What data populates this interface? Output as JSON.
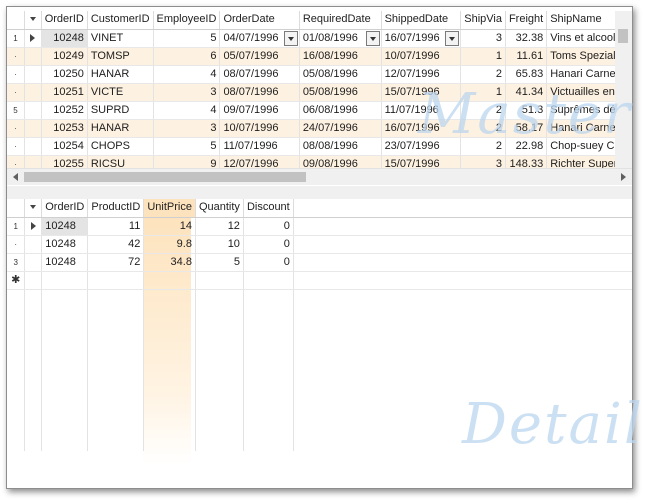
{
  "master": {
    "columns": [
      "OrderID",
      "CustomerID",
      "EmployeeID",
      "OrderDate",
      "RequiredDate",
      "ShippedDate",
      "ShipVia",
      "Freight",
      "ShipName"
    ],
    "rows": [
      {
        "indicator": "1",
        "OrderID": "10248",
        "CustomerID": "VINET",
        "EmployeeID": "5",
        "OrderDate": "04/07/1996",
        "RequiredDate": "01/08/1996",
        "ShippedDate": "16/07/1996",
        "ShipVia": "3",
        "Freight": "32.38",
        "ShipName": "Vins et alcools"
      },
      {
        "indicator": "·",
        "OrderID": "10249",
        "CustomerID": "TOMSP",
        "EmployeeID": "6",
        "OrderDate": "05/07/1996",
        "RequiredDate": "16/08/1996",
        "ShippedDate": "10/07/1996",
        "ShipVia": "1",
        "Freight": "11.61",
        "ShipName": "Toms Speziali"
      },
      {
        "indicator": "·",
        "OrderID": "10250",
        "CustomerID": "HANAR",
        "EmployeeID": "4",
        "OrderDate": "08/07/1996",
        "RequiredDate": "05/08/1996",
        "ShippedDate": "12/07/1996",
        "ShipVia": "2",
        "Freight": "65.83",
        "ShipName": "Hanari Carnes"
      },
      {
        "indicator": "·",
        "OrderID": "10251",
        "CustomerID": "VICTE",
        "EmployeeID": "3",
        "OrderDate": "08/07/1996",
        "RequiredDate": "05/08/1996",
        "ShippedDate": "15/07/1996",
        "ShipVia": "1",
        "Freight": "41.34",
        "ShipName": "Victuailles en"
      },
      {
        "indicator": "5",
        "OrderID": "10252",
        "CustomerID": "SUPRD",
        "EmployeeID": "4",
        "OrderDate": "09/07/1996",
        "RequiredDate": "06/08/1996",
        "ShippedDate": "11/07/1996",
        "ShipVia": "2",
        "Freight": "51.3",
        "ShipName": "Suprêmes déli"
      },
      {
        "indicator": "·",
        "OrderID": "10253",
        "CustomerID": "HANAR",
        "EmployeeID": "3",
        "OrderDate": "10/07/1996",
        "RequiredDate": "24/07/1996",
        "ShippedDate": "16/07/1996",
        "ShipVia": "2",
        "Freight": "58.17",
        "ShipName": "Hanari Carnes"
      },
      {
        "indicator": "·",
        "OrderID": "10254",
        "CustomerID": "CHOPS",
        "EmployeeID": "5",
        "OrderDate": "11/07/1996",
        "RequiredDate": "08/08/1996",
        "ShippedDate": "23/07/1996",
        "ShipVia": "2",
        "Freight": "22.98",
        "ShipName": "Chop-suey Ch"
      },
      {
        "indicator": "·",
        "OrderID": "10255",
        "CustomerID": "RICSU",
        "EmployeeID": "9",
        "OrderDate": "12/07/1996",
        "RequiredDate": "09/08/1996",
        "ShippedDate": "15/07/1996",
        "ShipVia": "3",
        "Freight": "148.33",
        "ShipName": "Richter Super"
      }
    ],
    "watermark": "Master"
  },
  "detail": {
    "columns": [
      "OrderID",
      "ProductID",
      "UnitPrice",
      "Quantity",
      "Discount"
    ],
    "rows": [
      {
        "indicator": "1",
        "OrderID": "10248",
        "ProductID": "11",
        "UnitPrice": "14",
        "Quantity": "12",
        "Discount": "0"
      },
      {
        "indicator": "·",
        "OrderID": "10248",
        "ProductID": "42",
        "UnitPrice": "9.8",
        "Quantity": "10",
        "Discount": "0"
      },
      {
        "indicator": "3",
        "OrderID": "10248",
        "ProductID": "72",
        "UnitPrice": "34.8",
        "Quantity": "5",
        "Discount": "0"
      }
    ],
    "new_row_indicator": "✱",
    "watermark": "Detail"
  },
  "colors": {
    "alt_row": "#fdf1e1",
    "highlight_column": "#fde3bd",
    "watermark": "#bcd6ef"
  }
}
